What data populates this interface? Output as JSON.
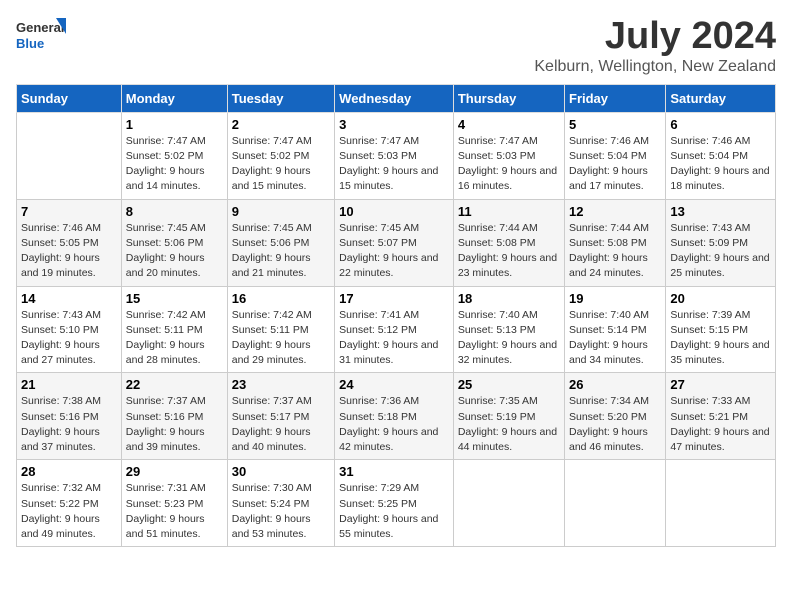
{
  "logo": {
    "general": "General",
    "blue": "Blue"
  },
  "title": "July 2024",
  "subtitle": "Kelburn, Wellington, New Zealand",
  "days_of_week": [
    "Sunday",
    "Monday",
    "Tuesday",
    "Wednesday",
    "Thursday",
    "Friday",
    "Saturday"
  ],
  "weeks": [
    [
      {
        "day": "",
        "sunrise": "",
        "sunset": "",
        "daylight": ""
      },
      {
        "day": "1",
        "sunrise": "Sunrise: 7:47 AM",
        "sunset": "Sunset: 5:02 PM",
        "daylight": "Daylight: 9 hours and 14 minutes."
      },
      {
        "day": "2",
        "sunrise": "Sunrise: 7:47 AM",
        "sunset": "Sunset: 5:02 PM",
        "daylight": "Daylight: 9 hours and 15 minutes."
      },
      {
        "day": "3",
        "sunrise": "Sunrise: 7:47 AM",
        "sunset": "Sunset: 5:03 PM",
        "daylight": "Daylight: 9 hours and 15 minutes."
      },
      {
        "day": "4",
        "sunrise": "Sunrise: 7:47 AM",
        "sunset": "Sunset: 5:03 PM",
        "daylight": "Daylight: 9 hours and 16 minutes."
      },
      {
        "day": "5",
        "sunrise": "Sunrise: 7:46 AM",
        "sunset": "Sunset: 5:04 PM",
        "daylight": "Daylight: 9 hours and 17 minutes."
      },
      {
        "day": "6",
        "sunrise": "Sunrise: 7:46 AM",
        "sunset": "Sunset: 5:04 PM",
        "daylight": "Daylight: 9 hours and 18 minutes."
      }
    ],
    [
      {
        "day": "7",
        "sunrise": "Sunrise: 7:46 AM",
        "sunset": "Sunset: 5:05 PM",
        "daylight": "Daylight: 9 hours and 19 minutes."
      },
      {
        "day": "8",
        "sunrise": "Sunrise: 7:45 AM",
        "sunset": "Sunset: 5:06 PM",
        "daylight": "Daylight: 9 hours and 20 minutes."
      },
      {
        "day": "9",
        "sunrise": "Sunrise: 7:45 AM",
        "sunset": "Sunset: 5:06 PM",
        "daylight": "Daylight: 9 hours and 21 minutes."
      },
      {
        "day": "10",
        "sunrise": "Sunrise: 7:45 AM",
        "sunset": "Sunset: 5:07 PM",
        "daylight": "Daylight: 9 hours and 22 minutes."
      },
      {
        "day": "11",
        "sunrise": "Sunrise: 7:44 AM",
        "sunset": "Sunset: 5:08 PM",
        "daylight": "Daylight: 9 hours and 23 minutes."
      },
      {
        "day": "12",
        "sunrise": "Sunrise: 7:44 AM",
        "sunset": "Sunset: 5:08 PM",
        "daylight": "Daylight: 9 hours and 24 minutes."
      },
      {
        "day": "13",
        "sunrise": "Sunrise: 7:43 AM",
        "sunset": "Sunset: 5:09 PM",
        "daylight": "Daylight: 9 hours and 25 minutes."
      }
    ],
    [
      {
        "day": "14",
        "sunrise": "Sunrise: 7:43 AM",
        "sunset": "Sunset: 5:10 PM",
        "daylight": "Daylight: 9 hours and 27 minutes."
      },
      {
        "day": "15",
        "sunrise": "Sunrise: 7:42 AM",
        "sunset": "Sunset: 5:11 PM",
        "daylight": "Daylight: 9 hours and 28 minutes."
      },
      {
        "day": "16",
        "sunrise": "Sunrise: 7:42 AM",
        "sunset": "Sunset: 5:11 PM",
        "daylight": "Daylight: 9 hours and 29 minutes."
      },
      {
        "day": "17",
        "sunrise": "Sunrise: 7:41 AM",
        "sunset": "Sunset: 5:12 PM",
        "daylight": "Daylight: 9 hours and 31 minutes."
      },
      {
        "day": "18",
        "sunrise": "Sunrise: 7:40 AM",
        "sunset": "Sunset: 5:13 PM",
        "daylight": "Daylight: 9 hours and 32 minutes."
      },
      {
        "day": "19",
        "sunrise": "Sunrise: 7:40 AM",
        "sunset": "Sunset: 5:14 PM",
        "daylight": "Daylight: 9 hours and 34 minutes."
      },
      {
        "day": "20",
        "sunrise": "Sunrise: 7:39 AM",
        "sunset": "Sunset: 5:15 PM",
        "daylight": "Daylight: 9 hours and 35 minutes."
      }
    ],
    [
      {
        "day": "21",
        "sunrise": "Sunrise: 7:38 AM",
        "sunset": "Sunset: 5:16 PM",
        "daylight": "Daylight: 9 hours and 37 minutes."
      },
      {
        "day": "22",
        "sunrise": "Sunrise: 7:37 AM",
        "sunset": "Sunset: 5:16 PM",
        "daylight": "Daylight: 9 hours and 39 minutes."
      },
      {
        "day": "23",
        "sunrise": "Sunrise: 7:37 AM",
        "sunset": "Sunset: 5:17 PM",
        "daylight": "Daylight: 9 hours and 40 minutes."
      },
      {
        "day": "24",
        "sunrise": "Sunrise: 7:36 AM",
        "sunset": "Sunset: 5:18 PM",
        "daylight": "Daylight: 9 hours and 42 minutes."
      },
      {
        "day": "25",
        "sunrise": "Sunrise: 7:35 AM",
        "sunset": "Sunset: 5:19 PM",
        "daylight": "Daylight: 9 hours and 44 minutes."
      },
      {
        "day": "26",
        "sunrise": "Sunrise: 7:34 AM",
        "sunset": "Sunset: 5:20 PM",
        "daylight": "Daylight: 9 hours and 46 minutes."
      },
      {
        "day": "27",
        "sunrise": "Sunrise: 7:33 AM",
        "sunset": "Sunset: 5:21 PM",
        "daylight": "Daylight: 9 hours and 47 minutes."
      }
    ],
    [
      {
        "day": "28",
        "sunrise": "Sunrise: 7:32 AM",
        "sunset": "Sunset: 5:22 PM",
        "daylight": "Daylight: 9 hours and 49 minutes."
      },
      {
        "day": "29",
        "sunrise": "Sunrise: 7:31 AM",
        "sunset": "Sunset: 5:23 PM",
        "daylight": "Daylight: 9 hours and 51 minutes."
      },
      {
        "day": "30",
        "sunrise": "Sunrise: 7:30 AM",
        "sunset": "Sunset: 5:24 PM",
        "daylight": "Daylight: 9 hours and 53 minutes."
      },
      {
        "day": "31",
        "sunrise": "Sunrise: 7:29 AM",
        "sunset": "Sunset: 5:25 PM",
        "daylight": "Daylight: 9 hours and 55 minutes."
      },
      {
        "day": "",
        "sunrise": "",
        "sunset": "",
        "daylight": ""
      },
      {
        "day": "",
        "sunrise": "",
        "sunset": "",
        "daylight": ""
      },
      {
        "day": "",
        "sunrise": "",
        "sunset": "",
        "daylight": ""
      }
    ]
  ]
}
